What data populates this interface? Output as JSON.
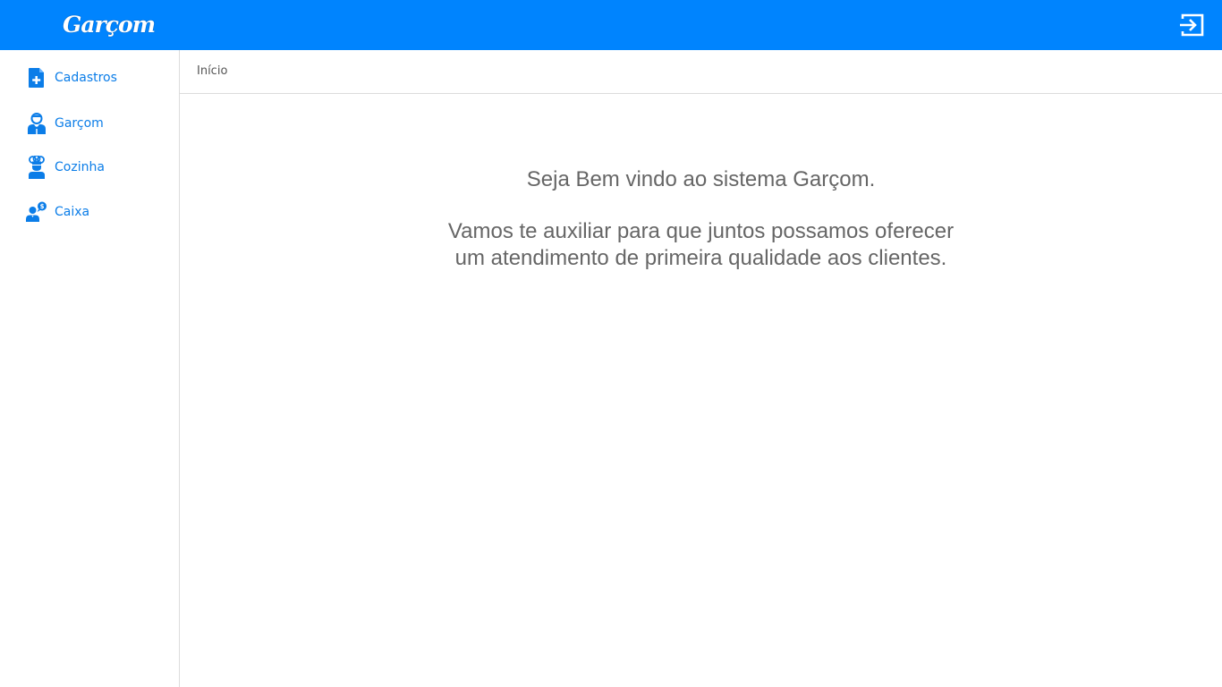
{
  "header": {
    "logo_text": "Garçom",
    "logout_icon": "logout-icon",
    "brand_color": "#0084fe"
  },
  "sidebar": {
    "items": [
      {
        "label": "Cadastros",
        "icon": "file-plus-icon"
      },
      {
        "label": "Garçom",
        "icon": "waiter-icon"
      },
      {
        "label": "Cozinha",
        "icon": "chef-icon"
      },
      {
        "label": "Caixa",
        "icon": "cashier-icon"
      }
    ],
    "link_color": "#0b7de8"
  },
  "breadcrumb": {
    "current": "Início"
  },
  "main": {
    "welcome_line1": "Seja Bem vindo ao sistema Garçom.",
    "welcome_line2": "Vamos te auxiliar para que juntos possamos oferecer",
    "welcome_line3": "um atendimento de primeira qualidade aos clientes."
  }
}
